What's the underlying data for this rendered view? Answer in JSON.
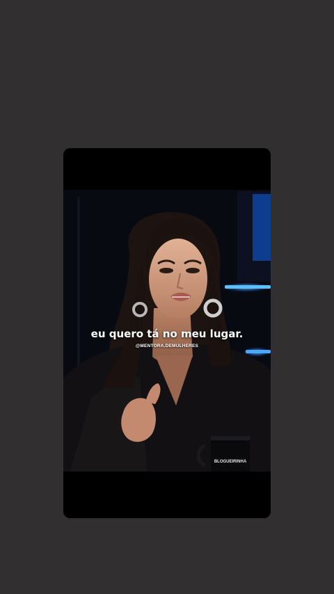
{
  "video": {
    "caption": "eu quero tá no meu lugar.",
    "watermark": "@MENTORA.DEMULHERES",
    "mug_text": "BLOGUEIRINHA"
  },
  "colors": {
    "page_background": "#312f2f",
    "video_background": "#000000",
    "neon_blue": "#4fb4ff",
    "caption_text": "#ffffff"
  }
}
